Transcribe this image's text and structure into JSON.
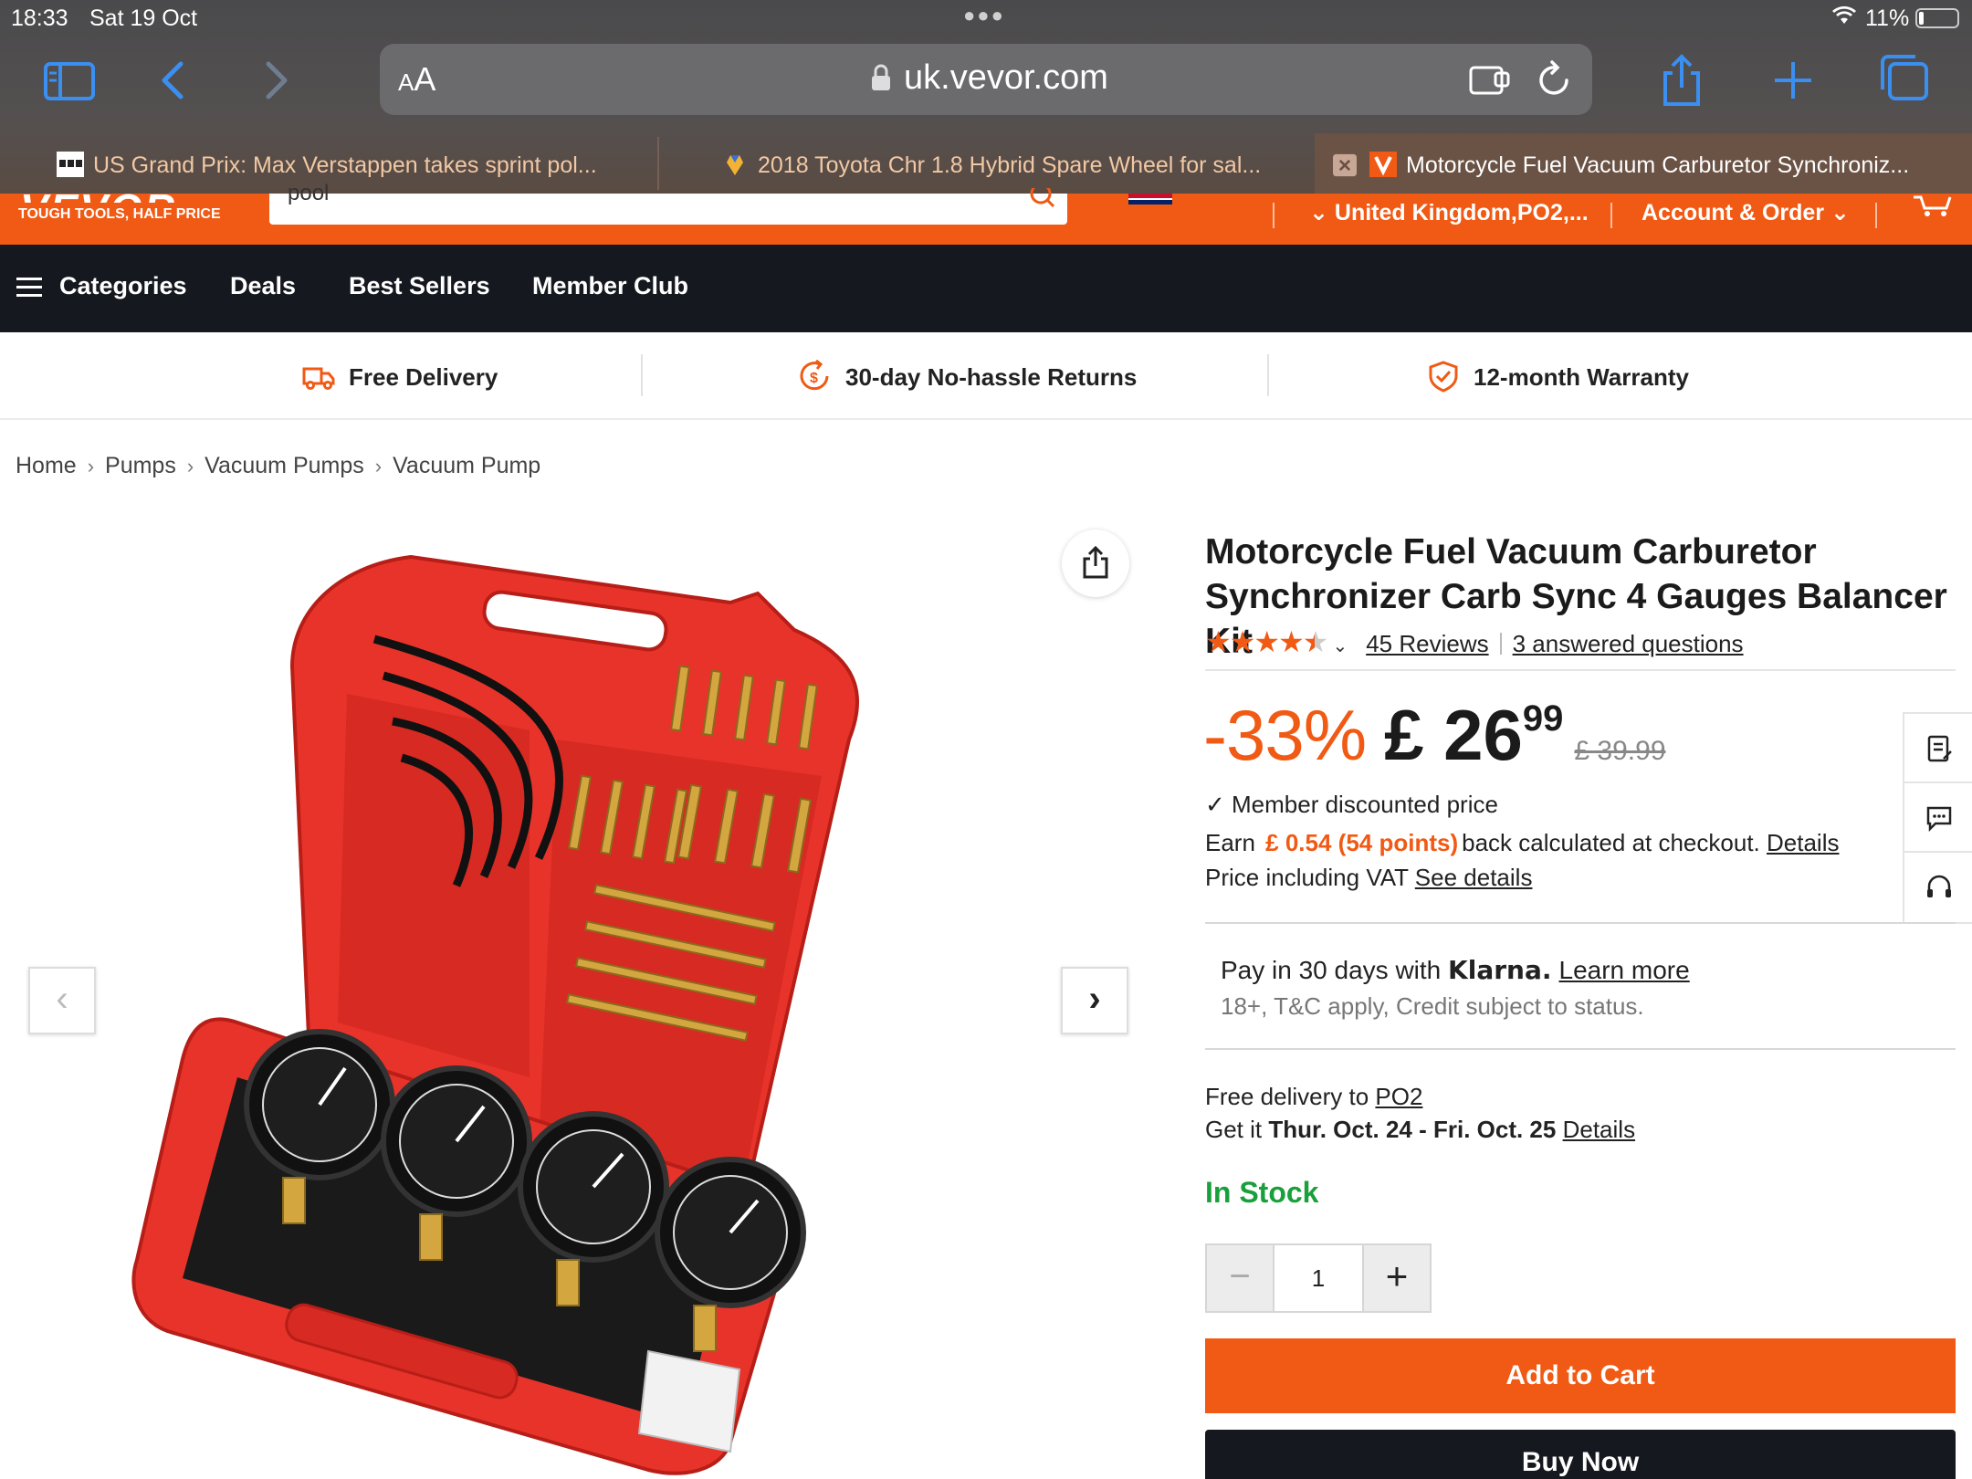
{
  "status_bar": {
    "time": "18:33",
    "date": "Sat 19 Oct",
    "battery": "11%"
  },
  "browser": {
    "aa_label_small": "A",
    "aa_label_large": "A",
    "url": "uk.vevor.com",
    "tabs": [
      {
        "title": "US Grand Prix: Max Verstappen takes sprint pol...",
        "active": false
      },
      {
        "title": "2018 Toyota Chr 1.8 Hybrid Spare Wheel for sal...",
        "active": false
      },
      {
        "title": "Motorcycle Fuel Vacuum Carburetor Synchroniz...",
        "active": true
      }
    ]
  },
  "site_header": {
    "logo": "VEVOR",
    "tagline": "TOUGH TOOLS, HALF PRICE",
    "search_query": "pool",
    "language": "EN",
    "ship_to": "United Kingdom,PO2,...",
    "account": "Account & Order"
  },
  "nav": {
    "items": [
      "Categories",
      "Deals",
      "Best Sellers",
      "Member Club"
    ]
  },
  "benefits": [
    "Free Delivery",
    "30-day No-hassle Returns",
    "12-month Warranty"
  ],
  "breadcrumb": [
    "Home",
    "Pumps",
    "Vacuum Pumps",
    "Vacuum Pump"
  ],
  "product": {
    "title": "Motorcycle Fuel Vacuum Carburetor Synchronizer Carb Sync 4 Gauges Balancer Kit",
    "rating": 4.5,
    "reviews": "45 Reviews",
    "questions": "3 answered questions",
    "discount": "-33%",
    "price_main": "£ 26",
    "price_cents": "99",
    "price_old": "£ 39.99",
    "member_price": "Member discounted price",
    "earn_prefix": "Earn",
    "earn_points": "£ 0.54 (54 points)",
    "earn_suffix": "back calculated at checkout.",
    "details_link": "Details",
    "vat_text": "Price including VAT",
    "vat_link": "See details",
    "klarna_prefix": "Pay in 30 days with",
    "klarna_brand": "Klarna.",
    "klarna_link": "Learn more",
    "klarna_terms": "18+, T&C apply, Credit subject to status.",
    "delivery_prefix": "Free delivery to",
    "delivery_postcode": "PO2",
    "delivery_get": "Get it",
    "delivery_dates": "Thur. Oct. 24 - Fri. Oct. 25",
    "stock": "In Stock",
    "quantity": "1",
    "add_to_cart": "Add to Cart",
    "buy_now": "Buy Now"
  },
  "colors": {
    "brand_orange": "#f05a14",
    "nav_dark": "#15191f",
    "in_stock_green": "#18a03a"
  }
}
